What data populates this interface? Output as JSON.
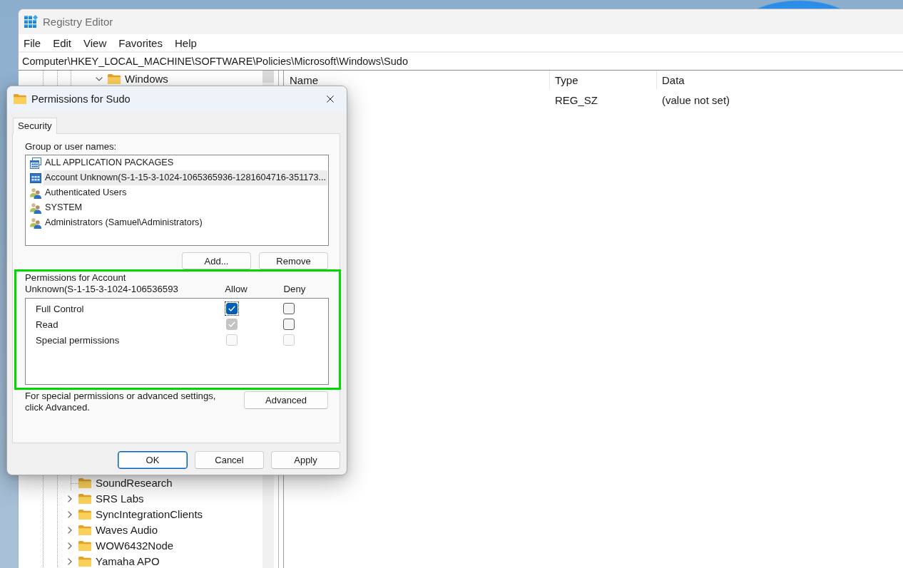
{
  "window": {
    "title": "Registry Editor"
  },
  "menu": [
    "File",
    "Edit",
    "View",
    "Favorites",
    "Help"
  ],
  "address_bar": {
    "value": "Computer\\HKEY_LOCAL_MACHINE\\SOFTWARE\\Policies\\Microsoft\\Windows\\Sudo"
  },
  "tree": {
    "items": [
      {
        "children": [
          {
            "children": [
              {
                "label": "Windows",
                "has_children": true,
                "expanded": true
              }
            ]
          }
        ]
      },
      {
        "label": "SoundResearch",
        "has_children": false
      },
      {
        "label": "SRS Labs",
        "has_children": true,
        "expanded": false
      },
      {
        "label": "SyncIntegrationClients",
        "has_children": true,
        "expanded": false
      },
      {
        "label": "Waves Audio",
        "has_children": true,
        "expanded": false
      },
      {
        "label": "WOW6432Node",
        "has_children": true,
        "expanded": false
      },
      {
        "label": "Yamaha APO",
        "has_children": true,
        "expanded": false
      }
    ]
  },
  "values": {
    "columns": [
      "Name",
      "Type",
      "Data"
    ],
    "rows": [
      {
        "type": "REG_SZ",
        "data": "(value not set)"
      }
    ]
  },
  "dialog": {
    "title": "Permissions for Sudo",
    "tabs": [
      {
        "label": "Security",
        "selected": true
      }
    ],
    "group_label": "Group or user names:",
    "principals": [
      {
        "kind": "packages",
        "name": "ALL APPLICATION PACKAGES",
        "selected": false
      },
      {
        "kind": "package",
        "name": "Account Unknown(S-1-15-3-1024-1065365936-1281604716-351173...",
        "selected": true
      },
      {
        "kind": "users",
        "name": "Authenticated Users",
        "selected": false
      },
      {
        "kind": "users",
        "name": "SYSTEM",
        "selected": false
      },
      {
        "kind": "users",
        "name": "Administrators (Samuel\\Administrators)",
        "selected": false
      }
    ],
    "principal_buttons": [
      "Add...",
      "Remove"
    ],
    "permissions": {
      "highlighted": true,
      "label": "Permissions for Account Unknown(S-1-15-3-1024-106536593",
      "columns": [
        "Allow",
        "Deny"
      ],
      "rows": [
        {
          "name": "Full Control",
          "allow": {
            "checked": true,
            "disabled": false,
            "focused": true
          },
          "deny": {
            "checked": false,
            "disabled": false,
            "focused": false
          }
        },
        {
          "name": "Read",
          "allow": {
            "checked": true,
            "disabled": true,
            "focused": false
          },
          "deny": {
            "checked": false,
            "disabled": false,
            "focused": false
          }
        },
        {
          "name": "Special permissions",
          "allow": {
            "checked": false,
            "disabled": true,
            "focused": false
          },
          "deny": {
            "checked": false,
            "disabled": true,
            "focused": false
          }
        }
      ]
    },
    "advanced_note": "For special permissions or advanced settings, click Advanced.",
    "advanced_button": "Advanced",
    "buttons": [
      {
        "label": "OK",
        "default": true
      },
      {
        "label": "Cancel",
        "default": false
      },
      {
        "label": "Apply",
        "default": false
      }
    ]
  }
}
